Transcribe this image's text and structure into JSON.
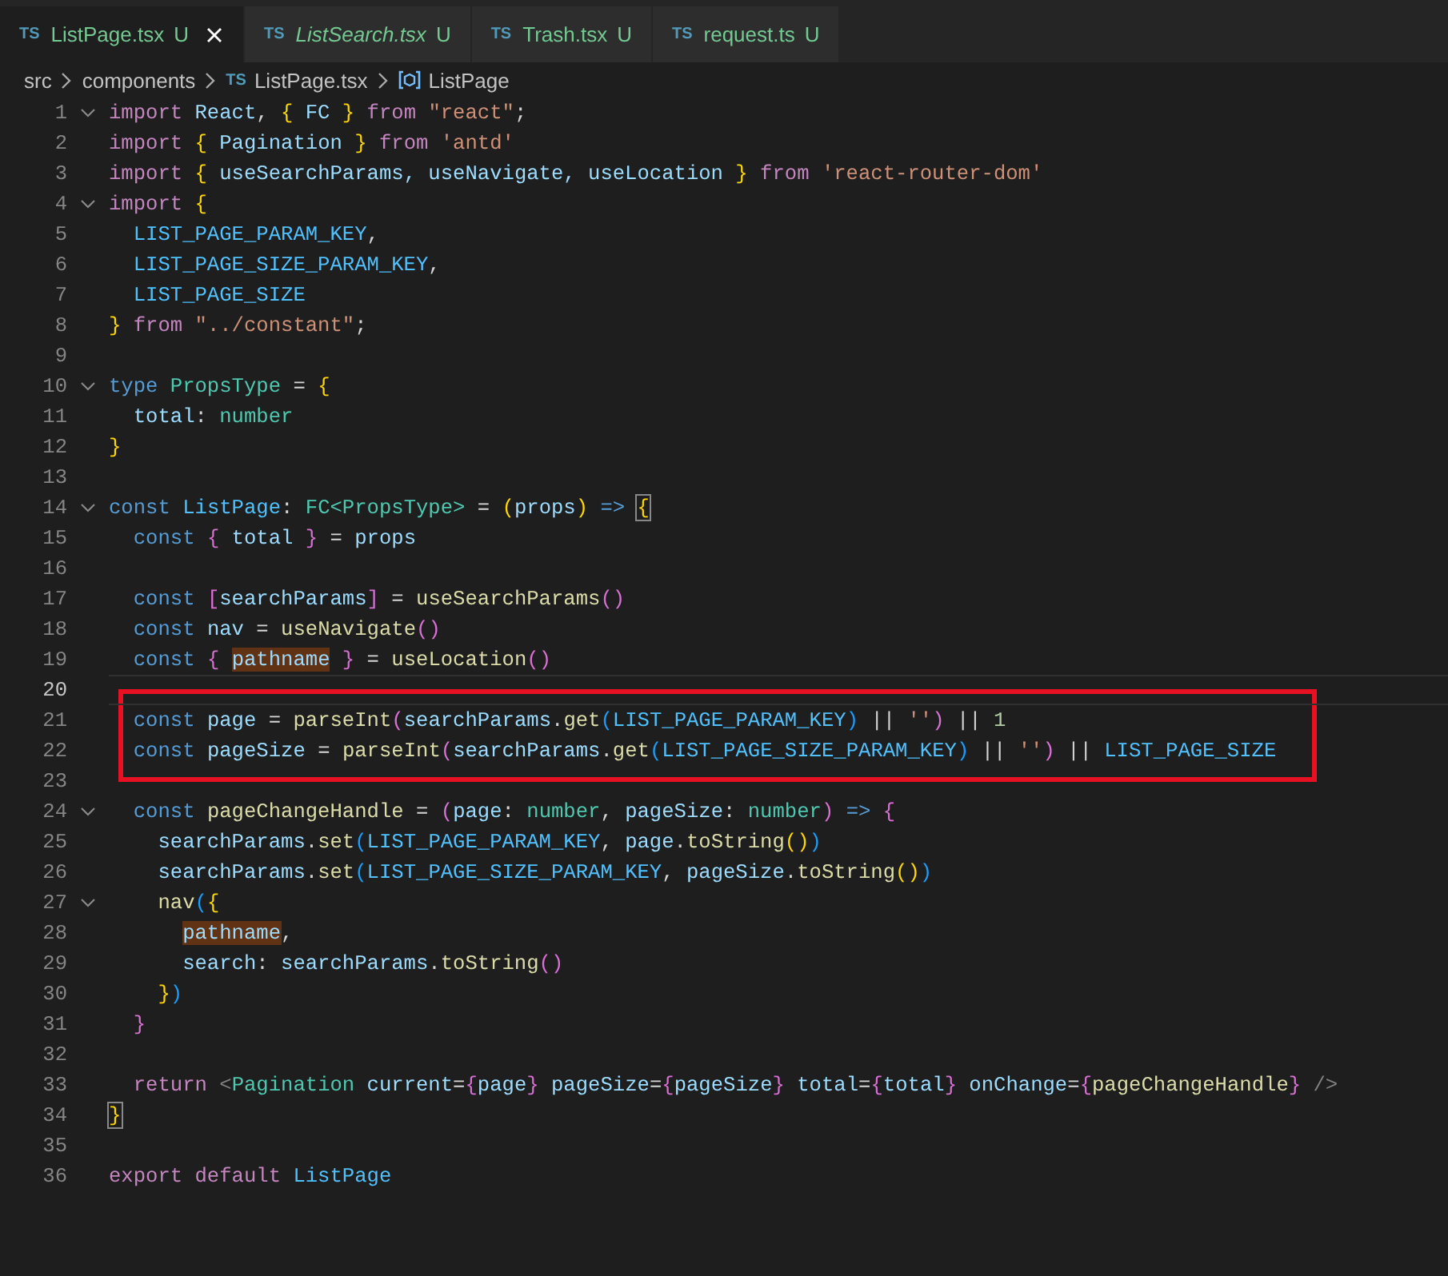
{
  "tabs": [
    {
      "badge": "TS",
      "label": "ListPage.tsx",
      "status": "U",
      "italic": false,
      "selected": true
    },
    {
      "badge": "TS",
      "label": "ListSearch.tsx",
      "status": "U",
      "italic": true,
      "selected": false
    },
    {
      "badge": "TS",
      "label": "Trash.tsx",
      "status": "U",
      "italic": false,
      "selected": false
    },
    {
      "badge": "TS",
      "label": "request.ts",
      "status": "U",
      "italic": false,
      "selected": false
    }
  ],
  "breadcrumb": [
    {
      "kind": "folder",
      "text": "src"
    },
    {
      "kind": "folder",
      "text": "components"
    },
    {
      "kind": "file",
      "badge": "TS",
      "text": "ListPage.tsx"
    },
    {
      "kind": "symbol",
      "text": "ListPage"
    }
  ],
  "lines": [
    {
      "number": "1",
      "foldable": true,
      "current": false,
      "boxed": false,
      "tokens": [
        {
          "t": "import",
          "kind": "keyword"
        },
        {
          "t": " React",
          "kind": "variable"
        },
        {
          "t": ", ",
          "kind": "punct"
        },
        {
          "t": "{",
          "kind": "bracket1"
        },
        {
          "t": " FC ",
          "kind": "variable"
        },
        {
          "t": "}",
          "kind": "bracket1"
        },
        {
          "t": " from ",
          "kind": "keyword"
        },
        {
          "t": "\"react\"",
          "kind": "string"
        },
        {
          "t": ";",
          "kind": "punct"
        }
      ]
    },
    {
      "number": "2",
      "foldable": false,
      "current": false,
      "boxed": false,
      "tokens": [
        {
          "t": "import ",
          "kind": "keyword"
        },
        {
          "t": "{",
          "kind": "bracket1"
        },
        {
          "t": " Pagination ",
          "kind": "variable"
        },
        {
          "t": "}",
          "kind": "bracket1"
        },
        {
          "t": " from ",
          "kind": "keyword"
        },
        {
          "t": "'antd'",
          "kind": "string"
        }
      ]
    },
    {
      "number": "3",
      "foldable": false,
      "current": false,
      "boxed": false,
      "tokens": [
        {
          "t": "import ",
          "kind": "keyword"
        },
        {
          "t": "{",
          "kind": "bracket1"
        },
        {
          "t": " useSearchParams, useNavigate, useLocation ",
          "kind": "variable"
        },
        {
          "t": "}",
          "kind": "bracket1"
        },
        {
          "t": " from ",
          "kind": "keyword"
        },
        {
          "t": "'react-router-dom'",
          "kind": "string"
        }
      ]
    },
    {
      "number": "4",
      "foldable": true,
      "current": false,
      "boxed": false,
      "tokens": [
        {
          "t": "import ",
          "kind": "keyword"
        },
        {
          "t": "{",
          "kind": "bracket1"
        }
      ]
    },
    {
      "number": "5",
      "foldable": false,
      "current": false,
      "boxed": false,
      "tokens": [
        {
          "t": "  LIST_PAGE_PARAM_KEY",
          "kind": "constant"
        },
        {
          "t": ",",
          "kind": "punct"
        }
      ]
    },
    {
      "number": "6",
      "foldable": false,
      "current": false,
      "boxed": false,
      "tokens": [
        {
          "t": "  LIST_PAGE_SIZE_PARAM_KEY",
          "kind": "constant"
        },
        {
          "t": ",",
          "kind": "punct"
        }
      ]
    },
    {
      "number": "7",
      "foldable": false,
      "current": false,
      "boxed": false,
      "tokens": [
        {
          "t": "  LIST_PAGE_SIZE",
          "kind": "constant"
        }
      ]
    },
    {
      "number": "8",
      "foldable": false,
      "current": false,
      "boxed": false,
      "tokens": [
        {
          "t": "}",
          "kind": "bracket1"
        },
        {
          "t": " from ",
          "kind": "keyword"
        },
        {
          "t": "\"../constant\"",
          "kind": "string"
        },
        {
          "t": ";",
          "kind": "punct"
        }
      ]
    },
    {
      "number": "9",
      "foldable": false,
      "current": false,
      "boxed": false
    },
    {
      "number": "10",
      "foldable": true,
      "current": false,
      "boxed": false,
      "tokens": [
        {
          "t": "type",
          "kind": "storage"
        },
        {
          "t": " PropsType",
          "kind": "type"
        },
        {
          "t": " = ",
          "kind": "punct"
        },
        {
          "t": "{",
          "kind": "bracket1"
        }
      ]
    },
    {
      "number": "11",
      "foldable": false,
      "current": false,
      "boxed": false,
      "tokens": [
        {
          "t": "  total",
          "kind": "variable"
        },
        {
          "t": ": ",
          "kind": "punct"
        },
        {
          "t": "number",
          "kind": "type"
        }
      ]
    },
    {
      "number": "12",
      "foldable": false,
      "current": false,
      "boxed": false,
      "tokens": [
        {
          "t": "}",
          "kind": "bracket1"
        }
      ]
    },
    {
      "number": "13",
      "foldable": false,
      "current": false,
      "boxed": false
    },
    {
      "number": "14",
      "foldable": true,
      "current": false,
      "boxed": false,
      "tokens": [
        {
          "t": "const",
          "kind": "storage"
        },
        {
          "t": " ListPage",
          "kind": "constant"
        },
        {
          "t": ": ",
          "kind": "punct"
        },
        {
          "t": "FC<PropsType>",
          "kind": "type"
        },
        {
          "t": " = ",
          "kind": "punct"
        },
        {
          "t": "(",
          "kind": "bracket1"
        },
        {
          "t": "props",
          "kind": "variable"
        },
        {
          "t": ")",
          "kind": "bracket1"
        },
        {
          "t": " => ",
          "kind": "storage"
        },
        {
          "t": "{",
          "kind": "bracket1",
          "matched": true
        }
      ]
    },
    {
      "number": "15",
      "foldable": false,
      "current": false,
      "boxed": false,
      "tokens": [
        {
          "t": "  const ",
          "kind": "storage"
        },
        {
          "t": "{",
          "kind": "bracket2"
        },
        {
          "t": " total ",
          "kind": "variable"
        },
        {
          "t": "}",
          "kind": "bracket2"
        },
        {
          "t": " = ",
          "kind": "punct"
        },
        {
          "t": "props",
          "kind": "variable"
        }
      ]
    },
    {
      "number": "16",
      "foldable": false,
      "current": false,
      "boxed": false
    },
    {
      "number": "17",
      "foldable": false,
      "current": false,
      "boxed": false,
      "tokens": [
        {
          "t": "  const ",
          "kind": "storage"
        },
        {
          "t": "[",
          "kind": "bracket2"
        },
        {
          "t": "searchParams",
          "kind": "variable"
        },
        {
          "t": "]",
          "kind": "bracket2"
        },
        {
          "t": " = ",
          "kind": "punct"
        },
        {
          "t": "useSearchParams",
          "kind": "function"
        },
        {
          "t": "()",
          "kind": "bracket2"
        }
      ]
    },
    {
      "number": "18",
      "foldable": false,
      "current": false,
      "boxed": false,
      "tokens": [
        {
          "t": "  const",
          "kind": "storage"
        },
        {
          "t": " nav",
          "kind": "variable"
        },
        {
          "t": " = ",
          "kind": "punct"
        },
        {
          "t": "useNavigate",
          "kind": "function"
        },
        {
          "t": "()",
          "kind": "bracket2"
        }
      ]
    },
    {
      "number": "19",
      "foldable": false,
      "current": false,
      "boxed": false,
      "tokens": [
        {
          "t": "  const ",
          "kind": "storage"
        },
        {
          "t": "{",
          "kind": "bracket2"
        },
        {
          "t": " pathname",
          "kind": "variable",
          "highlight": true
        },
        {
          "t": " }",
          "kind": "bracket2"
        },
        {
          "t": " = ",
          "kind": "punct"
        },
        {
          "t": "useLocation",
          "kind": "function"
        },
        {
          "t": "()",
          "kind": "bracket2"
        }
      ]
    },
    {
      "number": "20",
      "foldable": false,
      "current": true,
      "boxed": false
    },
    {
      "number": "21",
      "foldable": false,
      "current": false,
      "boxed": true,
      "tokens": [
        {
          "t": "  const",
          "kind": "storage"
        },
        {
          "t": " page",
          "kind": "variable"
        },
        {
          "t": " = ",
          "kind": "punct"
        },
        {
          "t": "parseInt",
          "kind": "function"
        },
        {
          "t": "(",
          "kind": "bracket2"
        },
        {
          "t": "searchParams",
          "kind": "variable"
        },
        {
          "t": ".",
          "kind": "punct"
        },
        {
          "t": "get",
          "kind": "function"
        },
        {
          "t": "(",
          "kind": "bracket3"
        },
        {
          "t": "LIST_PAGE_PARAM_KEY",
          "kind": "constant"
        },
        {
          "t": ")",
          "kind": "bracket3"
        },
        {
          "t": " || ",
          "kind": "punct"
        },
        {
          "t": "''",
          "kind": "string"
        },
        {
          "t": ")",
          "kind": "bracket2"
        },
        {
          "t": " || ",
          "kind": "punct"
        },
        {
          "t": "1",
          "kind": "number"
        }
      ]
    },
    {
      "number": "22",
      "foldable": false,
      "current": false,
      "boxed": true,
      "tokens": [
        {
          "t": "  const",
          "kind": "storage"
        },
        {
          "t": " pageSize",
          "kind": "variable"
        },
        {
          "t": " = ",
          "kind": "punct"
        },
        {
          "t": "parseInt",
          "kind": "function"
        },
        {
          "t": "(",
          "kind": "bracket2"
        },
        {
          "t": "searchParams",
          "kind": "variable"
        },
        {
          "t": ".",
          "kind": "punct"
        },
        {
          "t": "get",
          "kind": "function"
        },
        {
          "t": "(",
          "kind": "bracket3"
        },
        {
          "t": "LIST_PAGE_SIZE_PARAM_KEY",
          "kind": "constant"
        },
        {
          "t": ")",
          "kind": "bracket3"
        },
        {
          "t": " || ",
          "kind": "punct"
        },
        {
          "t": "''",
          "kind": "string"
        },
        {
          "t": ")",
          "kind": "bracket2"
        },
        {
          "t": " || ",
          "kind": "punct"
        },
        {
          "t": "LIST_PAGE_SIZE",
          "kind": "constant"
        }
      ]
    },
    {
      "number": "23",
      "foldable": false,
      "current": false,
      "boxed": false
    },
    {
      "number": "24",
      "foldable": true,
      "current": false,
      "boxed": false,
      "tokens": [
        {
          "t": "  const",
          "kind": "storage"
        },
        {
          "t": " pageChangeHandle",
          "kind": "function"
        },
        {
          "t": " = ",
          "kind": "punct"
        },
        {
          "t": "(",
          "kind": "bracket2"
        },
        {
          "t": "page",
          "kind": "variable"
        },
        {
          "t": ": ",
          "kind": "punct"
        },
        {
          "t": "number",
          "kind": "type"
        },
        {
          "t": ", ",
          "kind": "punct"
        },
        {
          "t": "pageSize",
          "kind": "variable"
        },
        {
          "t": ": ",
          "kind": "punct"
        },
        {
          "t": "number",
          "kind": "type"
        },
        {
          "t": ")",
          "kind": "bracket2"
        },
        {
          "t": " => ",
          "kind": "storage"
        },
        {
          "t": "{",
          "kind": "bracket2"
        }
      ]
    },
    {
      "number": "25",
      "foldable": false,
      "current": false,
      "boxed": false,
      "tokens": [
        {
          "t": "    searchParams",
          "kind": "variable"
        },
        {
          "t": ".",
          "kind": "punct"
        },
        {
          "t": "set",
          "kind": "function"
        },
        {
          "t": "(",
          "kind": "bracket3"
        },
        {
          "t": "LIST_PAGE_PARAM_KEY",
          "kind": "constant"
        },
        {
          "t": ", ",
          "kind": "punct"
        },
        {
          "t": "page",
          "kind": "variable"
        },
        {
          "t": ".",
          "kind": "punct"
        },
        {
          "t": "toString",
          "kind": "function"
        },
        {
          "t": "()",
          "kind": "bracket1"
        },
        {
          "t": ")",
          "kind": "bracket3"
        }
      ]
    },
    {
      "number": "26",
      "foldable": false,
      "current": false,
      "boxed": false,
      "tokens": [
        {
          "t": "    searchParams",
          "kind": "variable"
        },
        {
          "t": ".",
          "kind": "punct"
        },
        {
          "t": "set",
          "kind": "function"
        },
        {
          "t": "(",
          "kind": "bracket3"
        },
        {
          "t": "LIST_PAGE_SIZE_PARAM_KEY",
          "kind": "constant"
        },
        {
          "t": ", ",
          "kind": "punct"
        },
        {
          "t": "pageSize",
          "kind": "variable"
        },
        {
          "t": ".",
          "kind": "punct"
        },
        {
          "t": "toString",
          "kind": "function"
        },
        {
          "t": "()",
          "kind": "bracket1"
        },
        {
          "t": ")",
          "kind": "bracket3"
        }
      ]
    },
    {
      "number": "27",
      "foldable": true,
      "current": false,
      "boxed": false,
      "tokens": [
        {
          "t": "    nav",
          "kind": "function"
        },
        {
          "t": "(",
          "kind": "bracket3"
        },
        {
          "t": "{",
          "kind": "bracket1"
        }
      ]
    },
    {
      "number": "28",
      "foldable": false,
      "current": false,
      "boxed": false,
      "tokens": [
        {
          "t": "      pathname",
          "kind": "variable",
          "highlight": true
        },
        {
          "t": ",",
          "kind": "punct"
        }
      ]
    },
    {
      "number": "29",
      "foldable": false,
      "current": false,
      "boxed": false,
      "tokens": [
        {
          "t": "      search",
          "kind": "variable"
        },
        {
          "t": ": ",
          "kind": "punct"
        },
        {
          "t": "searchParams",
          "kind": "variable"
        },
        {
          "t": ".",
          "kind": "punct"
        },
        {
          "t": "toString",
          "kind": "function"
        },
        {
          "t": "()",
          "kind": "bracket2"
        }
      ]
    },
    {
      "number": "30",
      "foldable": false,
      "current": false,
      "boxed": false,
      "tokens": [
        {
          "t": "    }",
          "kind": "bracket1"
        },
        {
          "t": ")",
          "kind": "bracket3"
        }
      ]
    },
    {
      "number": "31",
      "foldable": false,
      "current": false,
      "boxed": false,
      "tokens": [
        {
          "t": "  }",
          "kind": "bracket2"
        }
      ]
    },
    {
      "number": "32",
      "foldable": false,
      "current": false,
      "boxed": false
    },
    {
      "number": "33",
      "foldable": false,
      "current": false,
      "boxed": false,
      "tokens": [
        {
          "t": "  return ",
          "kind": "keyword"
        },
        {
          "t": "<",
          "kind": "tag"
        },
        {
          "t": "Pagination",
          "kind": "type"
        },
        {
          "t": " current",
          "kind": "variable"
        },
        {
          "t": "=",
          "kind": "punct"
        },
        {
          "t": "{",
          "kind": "bracket2"
        },
        {
          "t": "page",
          "kind": "variable"
        },
        {
          "t": "}",
          "kind": "bracket2"
        },
        {
          "t": " pageSize",
          "kind": "variable"
        },
        {
          "t": "=",
          "kind": "punct"
        },
        {
          "t": "{",
          "kind": "bracket2"
        },
        {
          "t": "pageSize",
          "kind": "variable"
        },
        {
          "t": "}",
          "kind": "bracket2"
        },
        {
          "t": " total",
          "kind": "variable"
        },
        {
          "t": "=",
          "kind": "punct"
        },
        {
          "t": "{",
          "kind": "bracket2"
        },
        {
          "t": "total",
          "kind": "variable"
        },
        {
          "t": "}",
          "kind": "bracket2"
        },
        {
          "t": " onChange",
          "kind": "variable"
        },
        {
          "t": "=",
          "kind": "punct"
        },
        {
          "t": "{",
          "kind": "bracket2"
        },
        {
          "t": "pageChangeHandle",
          "kind": "function"
        },
        {
          "t": "}",
          "kind": "bracket2"
        },
        {
          "t": " />",
          "kind": "tag"
        }
      ]
    },
    {
      "number": "34",
      "foldable": false,
      "current": false,
      "boxed": false,
      "tokens": [
        {
          "t": "}",
          "kind": "bracket1",
          "matched": true
        }
      ]
    },
    {
      "number": "35",
      "foldable": false,
      "current": false,
      "boxed": false
    },
    {
      "number": "36",
      "foldable": false,
      "current": false,
      "boxed": false,
      "tokens": [
        {
          "t": "export default",
          "kind": "keyword"
        },
        {
          "t": " ListPage",
          "kind": "constant"
        }
      ]
    }
  ]
}
